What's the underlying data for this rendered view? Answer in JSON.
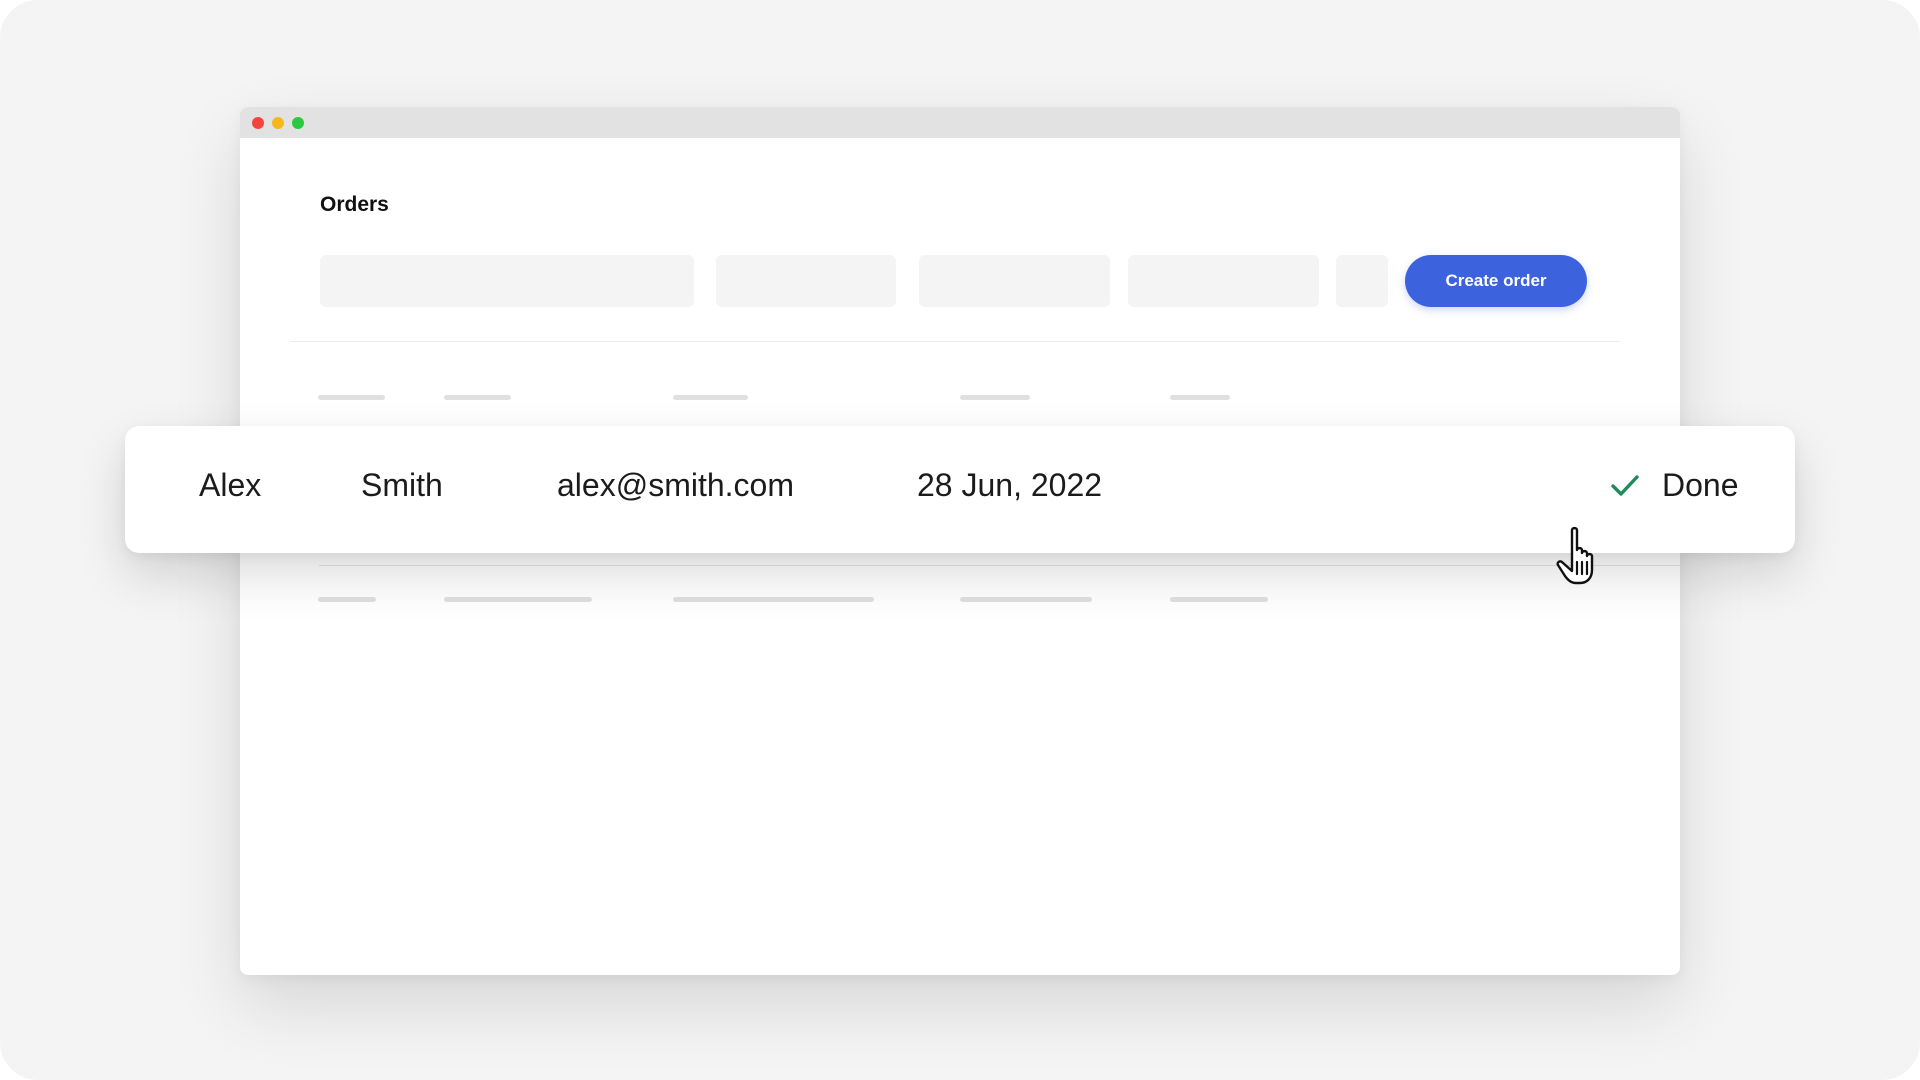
{
  "page": {
    "title": "Orders"
  },
  "toolbar": {
    "create_label": "Create order"
  },
  "row": {
    "first_name": "Alex",
    "last_name": "Smith",
    "email": "alex@smith.com",
    "date": "28 Jun, 2022",
    "status": "Done",
    "status_icon": "check-icon"
  },
  "colors": {
    "accent": "#3c63dd",
    "status_done": "#1f8a5b",
    "window_close": "#f2433d",
    "window_minimize": "#f7b81e",
    "window_maximize": "#2bc840"
  },
  "cursor": {
    "icon": "hand-pointer-icon"
  }
}
